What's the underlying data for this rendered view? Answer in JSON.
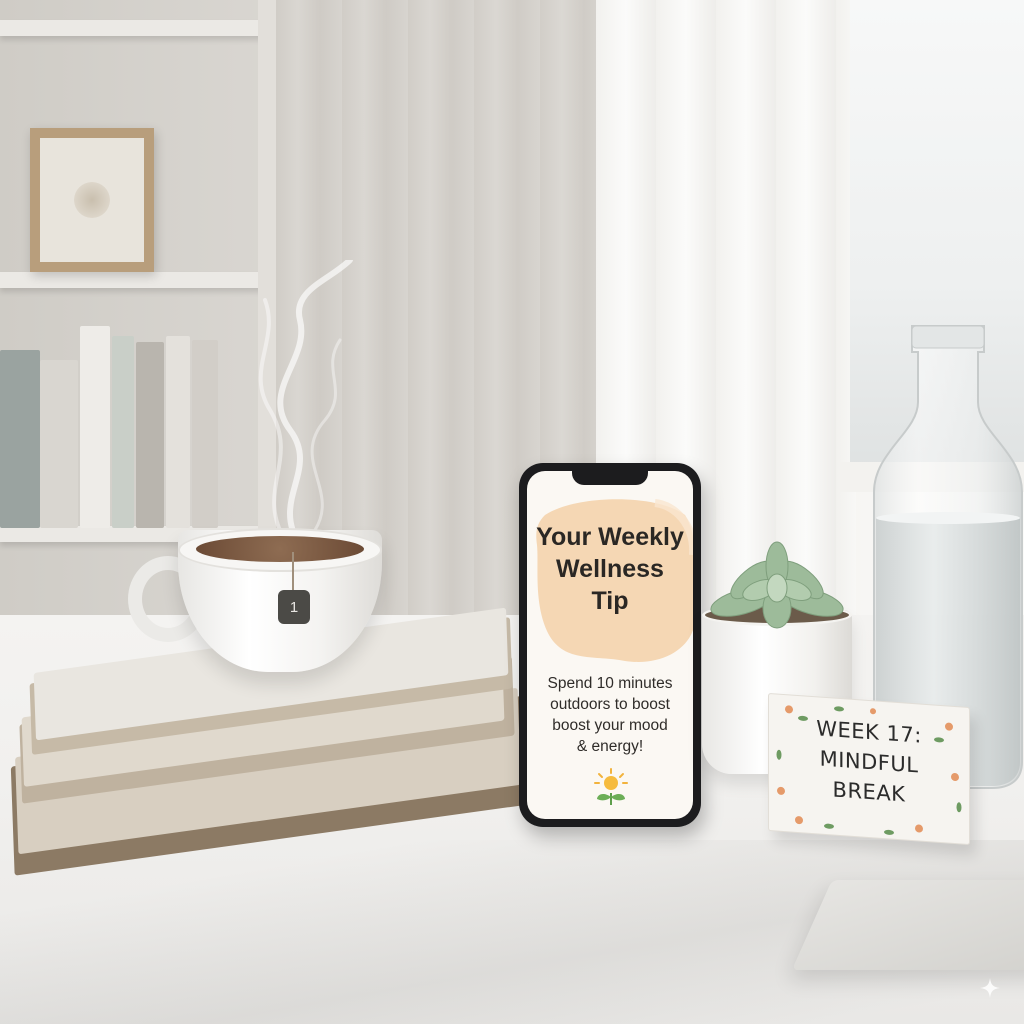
{
  "phone_screen": {
    "title": "Your Weekly Wellness Tip",
    "title_lines": [
      "Your Weekly",
      "Wellness",
      "Tip"
    ],
    "body_lines": [
      "Spend 10 minutes",
      "outdoors to boost",
      "boost your mood",
      "& energy!"
    ],
    "icon": "sun-sprout-icon",
    "accent_color": "#f5d7b4"
  },
  "tea_tag": {
    "label": "1"
  },
  "tent_card": {
    "lines": [
      "WEEK 17:",
      "MINDFUL",
      "BREAK"
    ]
  },
  "colors": {
    "wall": "#dedbd6",
    "desk": "#f1f0ee",
    "phone_frame": "#1c1c1e",
    "tea": "#7a5a42",
    "succulent": "#9dbb9a"
  }
}
